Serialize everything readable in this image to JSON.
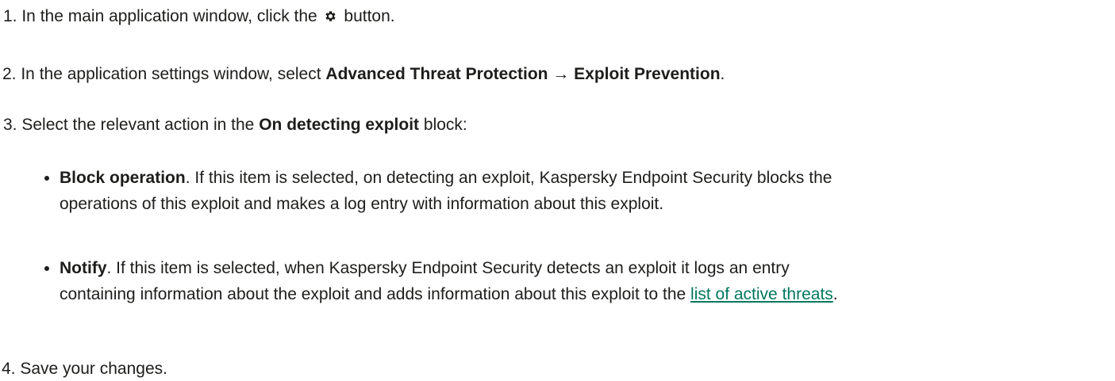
{
  "steps": [
    {
      "number": "1.",
      "before": " In the main application window, click the ",
      "icon": "gear-icon",
      "after": " button."
    },
    {
      "number": "2.",
      "before": " In the application settings window, select ",
      "bold1": "Advanced Threat Protection",
      "arrow": " → ",
      "bold2": "Exploit Prevention",
      "after": "."
    },
    {
      "number": "3.",
      "before": " Select the relevant action in the ",
      "bold": "On detecting exploit",
      "after": " block:"
    },
    {
      "number": "4.",
      "text": " Save your changes."
    }
  ],
  "bullets": [
    {
      "bold": "Block operation",
      "line1": ". If this item is selected, on detecting an exploit, Kaspersky Endpoint Security blocks the",
      "line2": "operations of this exploit and makes a log entry with information about this exploit."
    },
    {
      "bold": "Notify",
      "line1": ". If this item is selected, when Kaspersky Endpoint Security detects an exploit it logs an entry",
      "line2": "containing information about the exploit and adds information about this exploit to the ",
      "link": "list of active threats",
      "after": "."
    }
  ],
  "colors": {
    "text": "#1d1d1b",
    "link": "#00785f",
    "background": "#ffffff"
  }
}
